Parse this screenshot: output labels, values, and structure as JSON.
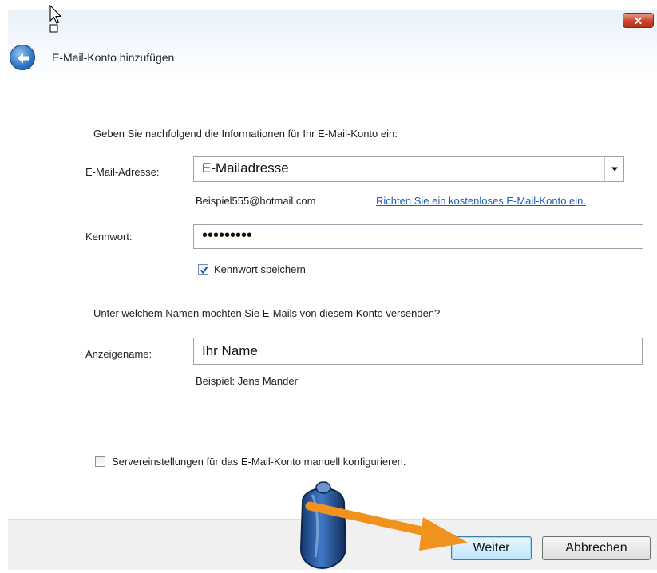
{
  "window": {
    "close_glyph": "✕",
    "title": "E-Mail-Konto hinzufügen"
  },
  "form": {
    "intro": "Geben Sie nachfolgend die Informationen für Ihr E-Mail-Konto ein:",
    "email_label": "E-Mail-Adresse:",
    "email_value": "E-Mailadresse",
    "email_example": "Beispiel555@hotmail.com",
    "create_account_link": "Richten Sie ein kostenloses E-Mail-Konto ein.",
    "password_label": "Kennwort:",
    "password_value": "•••••••••",
    "save_password_label": "Kennwort speichern",
    "save_password_checked": true,
    "name_question": "Unter welchem Namen möchten Sie E-Mails von diesem Konto versenden?",
    "display_name_label": "Anzeigename:",
    "display_name_value": "Ihr Name",
    "display_name_example": "Beispiel: Jens Mander",
    "manual_config_label": "Servereinstellungen für das E-Mail-Konto manuell konfigurieren.",
    "manual_config_checked": false
  },
  "footer": {
    "next_button": "Weiter",
    "cancel_button": "Abbrechen"
  },
  "colors": {
    "link": "#1a5fbf",
    "arrow_overlay": "#f0921e",
    "mouse_overlay": "#2e5fa8"
  },
  "icons": {
    "back": "back-arrow-icon",
    "cursor": "pointer-cursor-icon",
    "dropdown": "chevron-down-icon",
    "check": "checkmark-icon"
  }
}
